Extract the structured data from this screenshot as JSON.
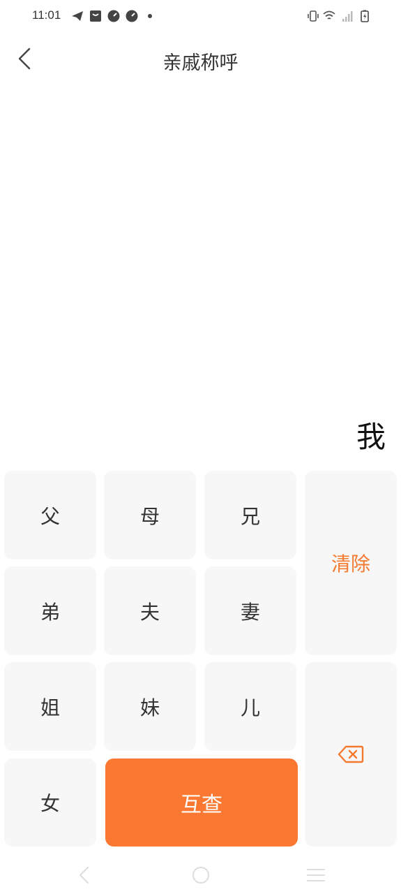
{
  "status_bar": {
    "time": "11:01",
    "left_icons": [
      "telegram-icon",
      "bag-icon",
      "gauge-icon",
      "gauge-icon",
      "dot-icon"
    ],
    "right_icons": [
      "vibrate-icon",
      "wifi-icon",
      "signal-icon",
      "battery-charging-icon"
    ]
  },
  "header": {
    "title": "亲戚称呼",
    "back_icon": "chevron-left-icon"
  },
  "result": {
    "text": "我"
  },
  "keypad": {
    "keys": {
      "father": "父",
      "mother": "母",
      "elder_brother": "兄",
      "younger_brother": "弟",
      "husband": "夫",
      "wife": "妻",
      "elder_sister": "姐",
      "younger_sister": "妹",
      "son": "儿",
      "daughter": "女"
    },
    "clear_label": "清除",
    "query_label": "互查",
    "backspace_icon": "backspace-icon"
  },
  "colors": {
    "accent": "#fb7832",
    "clear_text": "#f57a30",
    "key_background": "#f7f7f7",
    "text": "#333333"
  },
  "nav_bar": {
    "icons": [
      "nav-back-icon",
      "nav-home-icon",
      "nav-menu-icon"
    ]
  }
}
